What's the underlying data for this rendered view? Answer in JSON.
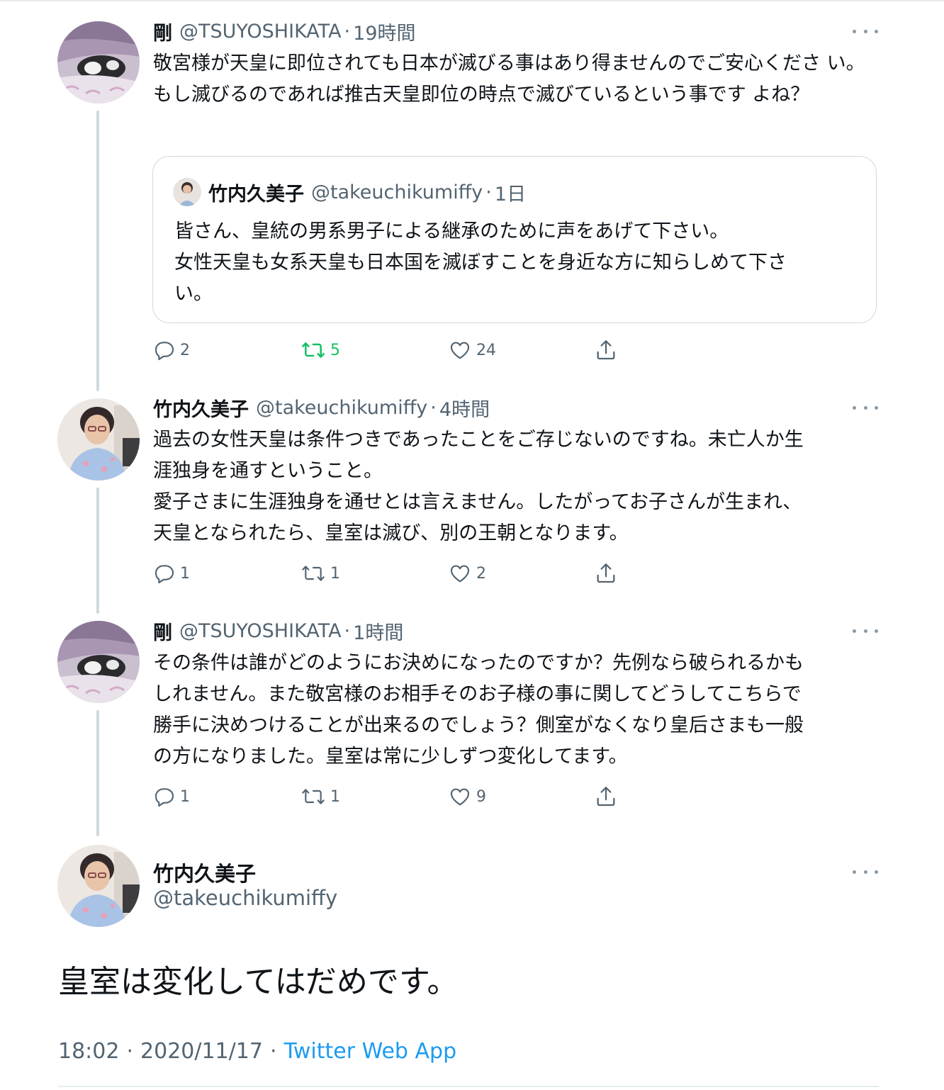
{
  "tweets": [
    {
      "name": "剛",
      "handle": "@TSUYOSHIKATA",
      "separator": "·",
      "time": "19時間",
      "text": "敬宮様が天皇に即位されても日本が滅びる事はあり得ませんのでご安心くださ い。もし滅びるのであれば推古天皇即位の時点で滅びているという事です よね？",
      "quote": {
        "name": "竹内久美子",
        "handle": "@takeuchikumiffy",
        "separator": "·",
        "time": "1日",
        "text": "皆さん、皇統の男系男子による継承のために声をあげて下さい。\n女性天皇も女系天皇も日本国を滅ぼすことを身近な方に知らしめて下さ\nい。"
      },
      "replies": "2",
      "retweets": "5",
      "likes": "24"
    },
    {
      "name": "竹内久美子",
      "handle": "@takeuchikumiffy",
      "separator": "·",
      "time": "4時間",
      "text": "過去の女性天皇は条件つきであったことをご存じないのですね。未亡人か生\n涯独身を通すということ。\n愛子さまに生涯独身を通せとは言えません。したがってお子さんが生まれ、\n天皇となられたら、皇室は滅び、別の王朝となります。",
      "replies": "1",
      "retweets": "1",
      "likes": "2"
    },
    {
      "name": "剛",
      "handle": "@TSUYOSHIKATA",
      "separator": "·",
      "time": "1時間",
      "text": "その条件は誰がどのようにお決めになったのですか？先例なら破られるかも\nしれません。また敬宮様のお相手そのお子様の事に関してどうしてこちらで\n勝手に決めつけることが出来るのでしょう？側室がなくなり皇后さまも一般\nの方になりました。皇室は常に少しずつ変化してます。",
      "replies": "1",
      "retweets": "1",
      "likes": "9"
    }
  ],
  "main": {
    "name": "竹内久美子",
    "handle": "@takeuchikumiffy",
    "text": "皇室は変化してはだめです。",
    "time": "18:02",
    "date": "2020/11/17",
    "separator": "·",
    "source": "Twitter Web App"
  },
  "colors": {
    "text": "#0f1419",
    "secondary": "#536471",
    "retweet_active": "#17bf63",
    "link": "#1d9bf0",
    "thread_line": "#cfd9de"
  },
  "icons": [
    "more-icon",
    "reply-icon",
    "retweet-icon",
    "like-icon",
    "share-icon"
  ]
}
